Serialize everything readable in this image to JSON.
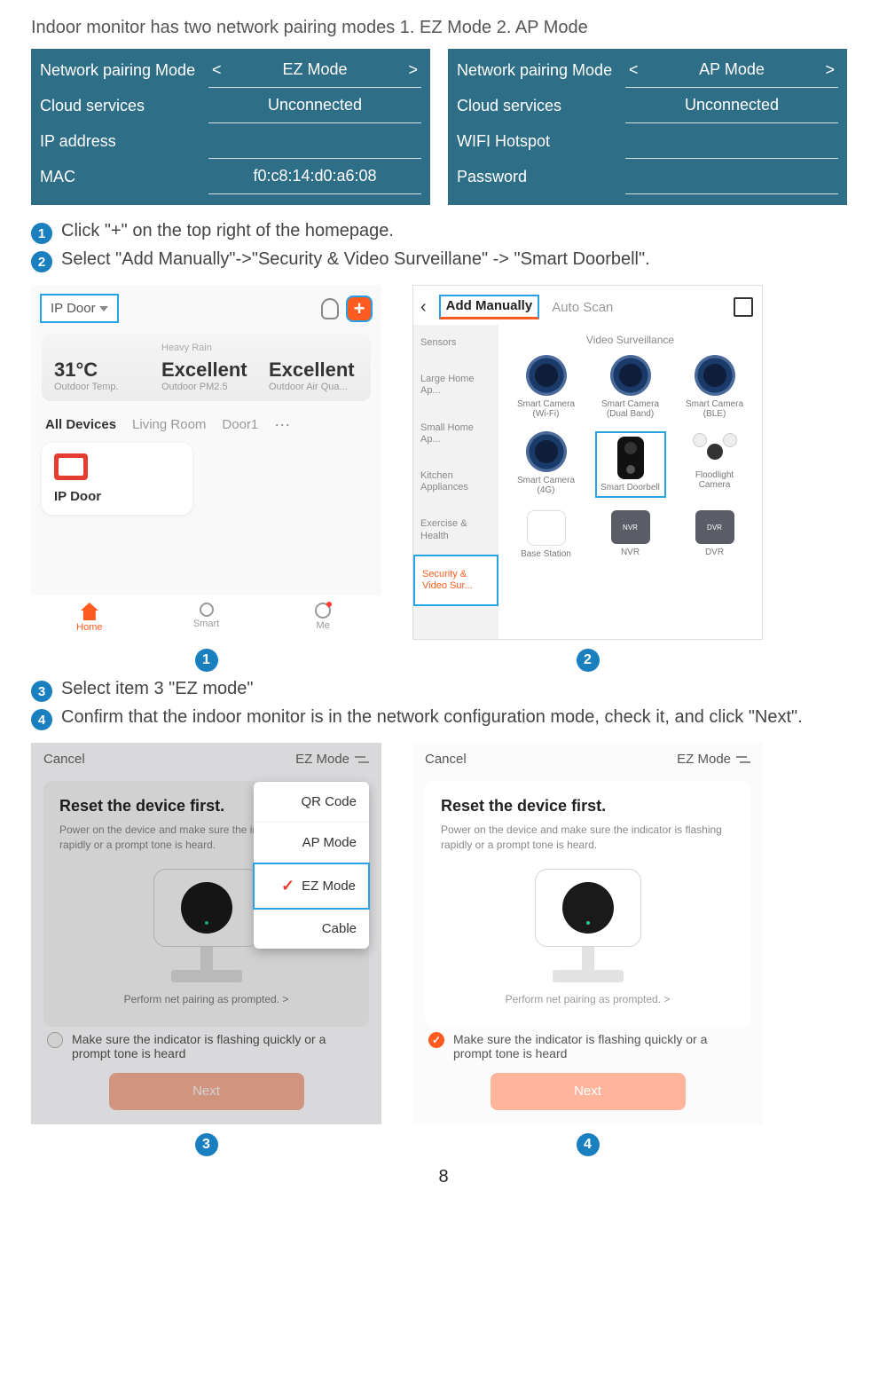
{
  "heading": "Indoor monitor has two network pairing modes 1. EZ Mode  2. AP Mode",
  "table_ez": {
    "rows": [
      {
        "label": "Network pairing Mode",
        "value": "EZ Mode",
        "arrows": true
      },
      {
        "label": "Cloud services",
        "value": "Unconnected"
      },
      {
        "label": "IP address",
        "value": ""
      },
      {
        "label": "MAC",
        "value": "f0:c8:14:d0:a6:08"
      }
    ]
  },
  "table_ap": {
    "rows": [
      {
        "label": "Network pairing Mode",
        "value": "AP Mode",
        "arrows": true
      },
      {
        "label": "Cloud services",
        "value": "Unconnected"
      },
      {
        "label": "WIFI Hotspot",
        "value": ""
      },
      {
        "label": "Password",
        "value": ""
      }
    ]
  },
  "steps": {
    "s1": "Click \"+\" on the top right of the homepage.",
    "s2": "Select \"Add Manually\"->\"Security & Video Surveillane\" -> \"Smart Doorbell\".",
    "s3": "Select item 3 \"EZ mode\"",
    "s4": "Confirm that the indoor monitor is in the network configuration mode, check it, and click \"Next\"."
  },
  "screen1": {
    "room": "IP Door",
    "plus": "+",
    "weather": {
      "heavy": "Heavy Rain",
      "temp": "31°C",
      "tempLabel": "Outdoor Temp.",
      "pm": "Excellent",
      "pmLabel": "Outdoor PM2.5",
      "air": "Excellent",
      "airLabel": "Outdoor Air Qua..."
    },
    "tabs": {
      "all": "All Devices",
      "living": "Living Room",
      "door": "Door1",
      "more": "···"
    },
    "device": "IP Door",
    "nav": {
      "home": "Home",
      "smart": "Smart",
      "me": "Me"
    }
  },
  "screen2": {
    "tabs": {
      "manual": "Add Manually",
      "auto": "Auto Scan"
    },
    "sideCats": [
      "Sensors",
      "Large Home Ap...",
      "Small Home Ap...",
      "Kitchen Appliances",
      "Exercise & Health",
      "Security & Video Sur..."
    ],
    "gridTitle": "Video Surveillance",
    "items": [
      [
        "Smart Camera (Wi-Fi)",
        "Smart Camera (Dual Band)",
        "Smart Camera (BLE)"
      ],
      [
        "Smart Camera (4G)",
        "Smart Doorbell",
        "Floodlight Camera"
      ],
      [
        "Base Station",
        "NVR",
        "DVR"
      ]
    ]
  },
  "screen3": {
    "cancel": "Cancel",
    "mode": "EZ Mode",
    "reset_title": "Reset the device first.",
    "reset_body": "Power on the device and make sure the indicator is flashing rapidly or a prompt tone is heard.",
    "sub": "Perform net pairing as prompted. >",
    "check": "Make sure the indicator is flashing quickly or a prompt tone is heard",
    "next": "Next",
    "menu": [
      "QR Code",
      "AP Mode",
      "EZ Mode",
      "Cable"
    ]
  },
  "badges": {
    "b1": "1",
    "b2": "2",
    "b3": "3",
    "b4": "4"
  },
  "page": "8"
}
